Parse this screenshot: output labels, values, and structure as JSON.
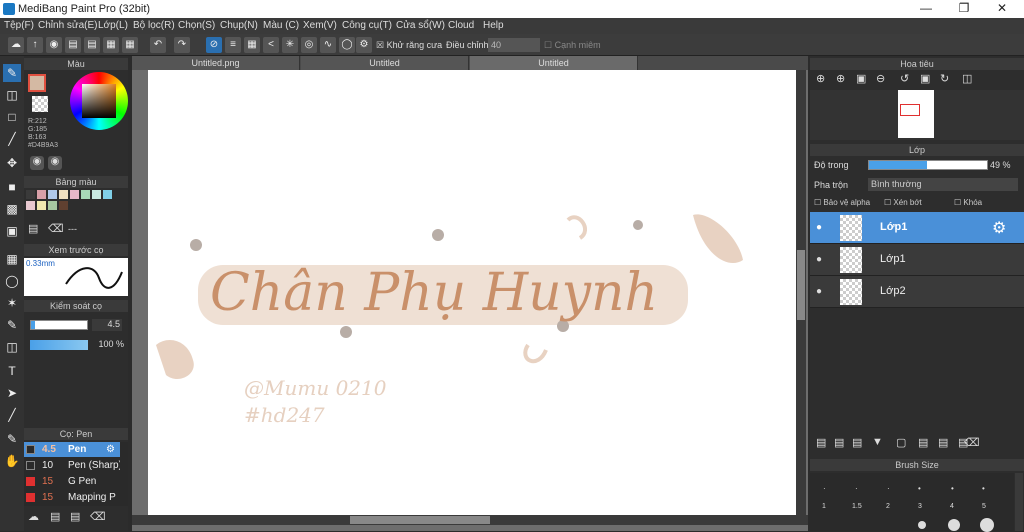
{
  "app": {
    "title": "MediBang Paint Pro (32bit)"
  },
  "menu": [
    "Tệp(F)",
    "Chỉnh sửa(E)",
    "Lớp(L)",
    "Bộ lọc(R)",
    "Chọn(S)",
    "Chụp(N)",
    "Màu (C)",
    "Xem(V)",
    "Công cụ(T)",
    "Cửa sổ(W)",
    "Cloud",
    "Help"
  ],
  "toolbar": {
    "antialias": "Khử răng cưa",
    "adjust_label": "Điều chỉnh",
    "adjust_value": "40",
    "edge": "Cạnh miêm"
  },
  "tabs": [
    "Untitled.png",
    "Untitled",
    "Untitled"
  ],
  "color_panel": {
    "title": "Màu",
    "r": "R:212",
    "g": "G:185",
    "b": "B:163",
    "hex": "#D4B9A3",
    "primary": "#d4b9a3"
  },
  "palette_panel": {
    "title": "Bảng màu",
    "label": "---",
    "colors": [
      "#3a3a3a",
      "#d8a0a8",
      "#b0c8e8",
      "#f0e0c0",
      "#e8b8c8",
      "#a8d8b8",
      "#c8e8e0",
      "#80d0e8",
      "#e8c8d0",
      "#f0e8b0",
      "#a8c8a0",
      "#604030"
    ]
  },
  "brush_preview": {
    "title": "Xem trước cọ",
    "size": "0.33mm"
  },
  "brush_control": {
    "title": "Kiểm soát cọ",
    "size": "4.5",
    "opacity": "100 %"
  },
  "brush_list": {
    "title": "Cọ: Pen",
    "items": [
      {
        "size": "4.5",
        "name": "Pen",
        "color": "#2a2a2a"
      },
      {
        "size": "10",
        "name": "Pen (Sharp)",
        "color": "#2a2a2a"
      },
      {
        "size": "15",
        "name": "G Pen",
        "color": "#e03030"
      },
      {
        "size": "15",
        "name": "Mapping P",
        "color": "#e03030"
      }
    ]
  },
  "navigator": {
    "title": "Hoa tiêu"
  },
  "layer_panel": {
    "title": "Lớp",
    "opacity_label": "Độ trong",
    "opacity_value": "49 %",
    "opacity_fraction": 0.49,
    "blend_label": "Pha trộn",
    "blend_value": "Bình thường",
    "protect": "Bảo vệ alpha",
    "clip": "Xén bớt",
    "lock": "Khóa",
    "layers": [
      "Lớp1",
      "Lớp1",
      "Lớp2"
    ]
  },
  "brush_size_panel": {
    "title": "Brush Size",
    "sizes": [
      "1",
      "1.5",
      "2",
      "3",
      "4",
      "5"
    ]
  },
  "artwork": {
    "main_text": "Chân Phụ Huynh",
    "signature_1": "@Mumu 0210",
    "signature_2": "#hd247"
  }
}
